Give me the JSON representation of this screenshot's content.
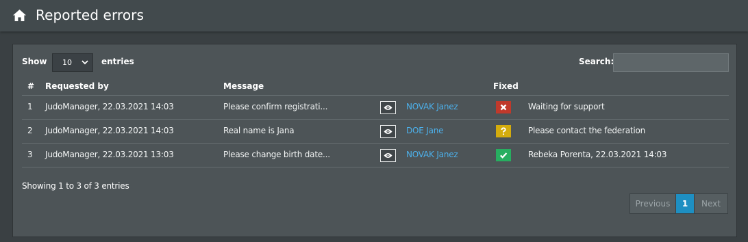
{
  "header": {
    "title": "Reported errors",
    "icon": "home-icon"
  },
  "controls": {
    "show_label": "Show",
    "page_length": "10",
    "entries_label": "entries",
    "search_label": "Search:",
    "search_value": ""
  },
  "table": {
    "headers": {
      "num": "#",
      "requested_by": "Requested by",
      "message": "Message",
      "fixed": "Fixed"
    },
    "rows": [
      {
        "num": "1",
        "requested_by": "JudoManager, 22.03.2021 14:03",
        "message": "Please confirm registrati...",
        "user": "NOVAK Janez",
        "fixed_state": "not-fixed",
        "status": "Waiting for support"
      },
      {
        "num": "2",
        "requested_by": "JudoManager, 22.03.2021 14:03",
        "message": "Real name is Jana",
        "user": "DOE Jane",
        "fixed_state": "question",
        "status": "Please contact the federation"
      },
      {
        "num": "3",
        "requested_by": "JudoManager, 22.03.2021 13:03",
        "message": "Please change birth date...",
        "user": "NOVAK Janez",
        "fixed_state": "fixed",
        "status": "Rebeka Porenta, 22.03.2021 14:03"
      }
    ]
  },
  "footer": {
    "info": "Showing 1 to 3 of 3 entries",
    "pagination": {
      "previous": "Previous",
      "current": "1",
      "next": "Next"
    }
  },
  "colors": {
    "background": "#3a4043",
    "panel": "#4d5457",
    "link": "#4db1ec",
    "active_page": "#1e8fc2",
    "red": "#c0392b",
    "yellow": "#d4ac0d",
    "green": "#27ae60"
  }
}
